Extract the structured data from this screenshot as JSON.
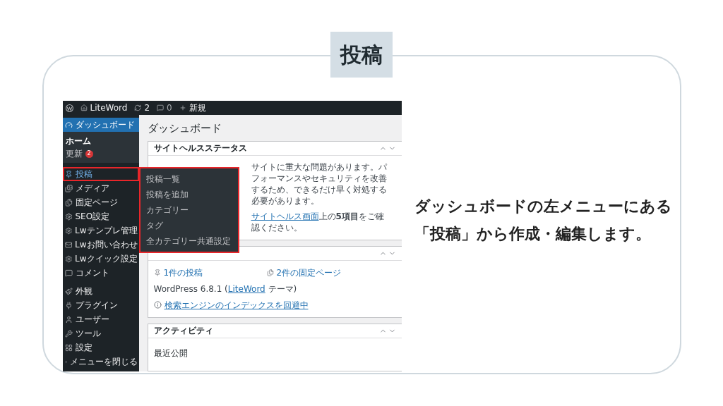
{
  "title_tag": "投稿",
  "admin_bar": {
    "site": "LiteWord",
    "updates": "2",
    "comments": "0",
    "new": "新規"
  },
  "sidebar": {
    "groups": [
      {
        "items": [
          {
            "label": "ダッシュボード",
            "selected": true,
            "highlighted": false,
            "children": [
              {
                "label": "ホーム",
                "selected": true
              },
              {
                "label": "更新",
                "badge": "2",
                "selected": false
              }
            ]
          }
        ]
      },
      {
        "items": [
          {
            "label": "投稿",
            "selected": false,
            "highlighted": true
          },
          {
            "label": "メディア",
            "selected": false,
            "highlighted": false
          },
          {
            "label": "固定ページ",
            "selected": false,
            "highlighted": false
          },
          {
            "label": "SEO設定",
            "selected": false,
            "highlighted": false
          },
          {
            "label": "Lwテンプレ管理",
            "selected": false,
            "highlighted": false
          },
          {
            "label": "Lwお問い合わせ",
            "selected": false,
            "highlighted": false
          },
          {
            "label": "Lwクイック設定",
            "selected": false,
            "highlighted": false
          },
          {
            "label": "コメント",
            "selected": false,
            "highlighted": false
          }
        ]
      },
      {
        "items": [
          {
            "label": "外観",
            "selected": false,
            "highlighted": false
          },
          {
            "label": "プラグイン",
            "selected": false,
            "highlighted": false
          },
          {
            "label": "ユーザー",
            "selected": false,
            "highlighted": false
          },
          {
            "label": "ツール",
            "selected": false,
            "highlighted": false
          },
          {
            "label": "設定",
            "selected": false,
            "highlighted": false
          },
          {
            "label": "メニューを閉じる",
            "selected": false,
            "highlighted": false
          }
        ]
      }
    ]
  },
  "flyout": {
    "items": [
      "投稿一覧",
      "投稿を追加",
      "カテゴリー",
      "タグ",
      "全カテゴリー共通設定"
    ]
  },
  "page_title": "ダッシュボード",
  "widgets": [
    {
      "kind": "health",
      "title": "サイトヘルスステータス",
      "text": "サイトに重大な問題があります。パフォーマンスやセキュリティを改善するため、できるだけ早く対処する必要があります。",
      "link": "サイトヘルス画面",
      "link_rest": "上の**5項目**をご確認ください。"
    },
    {
      "kind": "glance",
      "posts": "1件の投稿",
      "pages": "2件の固定ページ",
      "version": "WordPress 6.8.1 (",
      "theme_link": "LiteWord",
      "version_rest": " テーマ)",
      "notice": "検索エンジンのインデックスを回避中"
    },
    {
      "kind": "activity",
      "title": "アクティビティ",
      "subtitle": "最近公開"
    }
  ],
  "caption": [
    "ダッシュボードの左メニューにある",
    "「投稿」から作成・編集します。"
  ]
}
